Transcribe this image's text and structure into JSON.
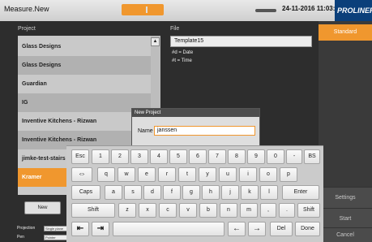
{
  "window": {
    "title": "Measure.New",
    "clock": "24-11-2016 11:03:37",
    "brand": "PROLINER"
  },
  "project_panel": {
    "header": "Project",
    "items": [
      {
        "label": "Glass Designs"
      },
      {
        "label": "Glass Designs"
      },
      {
        "label": "Guardian"
      },
      {
        "label": "IG"
      },
      {
        "label": "Inventive Kitchens - Rizwan"
      },
      {
        "label": "Inventive Kitchens - Rizwan"
      },
      {
        "label": "jimke-test-stairs"
      },
      {
        "label": "Kramer"
      }
    ],
    "new_button": "New"
  },
  "file_panel": {
    "header": "File",
    "template": "Template15",
    "date_hint": "#d = Date",
    "time_hint": "#t = Time"
  },
  "right_panel": {
    "standard": "Standard",
    "settings": "Settings",
    "start": "Start",
    "cancel": "Cancel"
  },
  "bottom_left": {
    "projection_label": "Projection",
    "projection_value": "Single plane",
    "pen_label": "Pen",
    "pen_value": "Pointer"
  },
  "dialog": {
    "title": "New Project",
    "name_label": "Name",
    "name_value": "janssen"
  },
  "keyboard": {
    "row1": [
      "Esc",
      "1",
      "2",
      "3",
      "4",
      "5",
      "6",
      "7",
      "8",
      "9",
      "0",
      "-",
      "BS"
    ],
    "row2": [
      "⇔",
      "q",
      "w",
      "e",
      "r",
      "t",
      "y",
      "u",
      "i",
      "o",
      "p"
    ],
    "row3": [
      "Caps",
      "a",
      "s",
      "d",
      "f",
      "g",
      "h",
      "j",
      "k",
      "l",
      "Enter"
    ],
    "row4": [
      "Shift",
      "z",
      "x",
      "c",
      "v",
      "b",
      "n",
      "m",
      ",",
      ".",
      "Shift"
    ],
    "row5": [
      "⇤",
      "⇥",
      "",
      "←",
      "→",
      "Del",
      "Done"
    ]
  },
  "colors": {
    "accent": "#f0972e",
    "brand_bg": "#0b3f7a",
    "background": "#2d2d2d"
  }
}
